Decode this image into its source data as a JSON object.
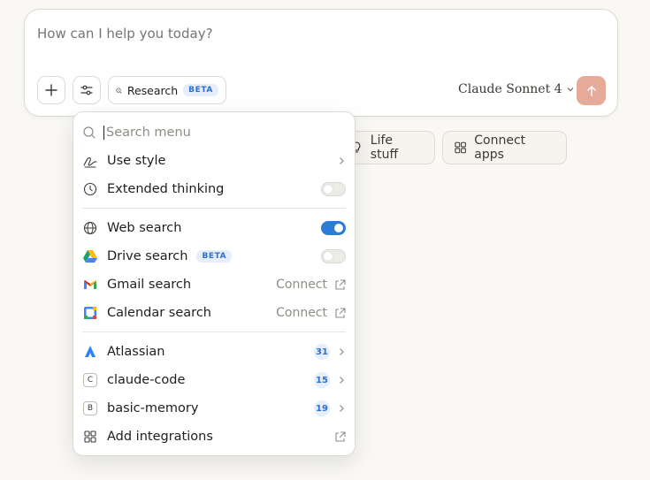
{
  "composer": {
    "placeholder": "How can I help you today?",
    "research_label": "Research",
    "research_badge": "BETA",
    "model": "Claude Sonnet 4",
    "send_color": "#e6ab98"
  },
  "chips": {
    "life_stuff": "Life stuff",
    "connect_apps": "Connect apps"
  },
  "menu": {
    "search_placeholder": "Search menu",
    "use_style": "Use style",
    "extended_thinking": "Extended thinking",
    "extended_thinking_on": false,
    "web_search": "Web search",
    "web_search_on": true,
    "drive_search": "Drive search",
    "drive_badge": "BETA",
    "drive_search_on": false,
    "gmail_search": "Gmail search",
    "gmail_connect": "Connect",
    "calendar_search": "Calendar search",
    "calendar_connect": "Connect",
    "integrations": [
      {
        "letter": "",
        "label": "Atlassian",
        "count": "31"
      },
      {
        "letter": "C",
        "label": "claude-code",
        "count": "15"
      },
      {
        "letter": "B",
        "label": "basic-memory",
        "count": "19"
      }
    ],
    "add_integrations": "Add integrations"
  },
  "colors": {
    "accent_blue": "#2d7bd8",
    "background": "#f9f8f4"
  }
}
